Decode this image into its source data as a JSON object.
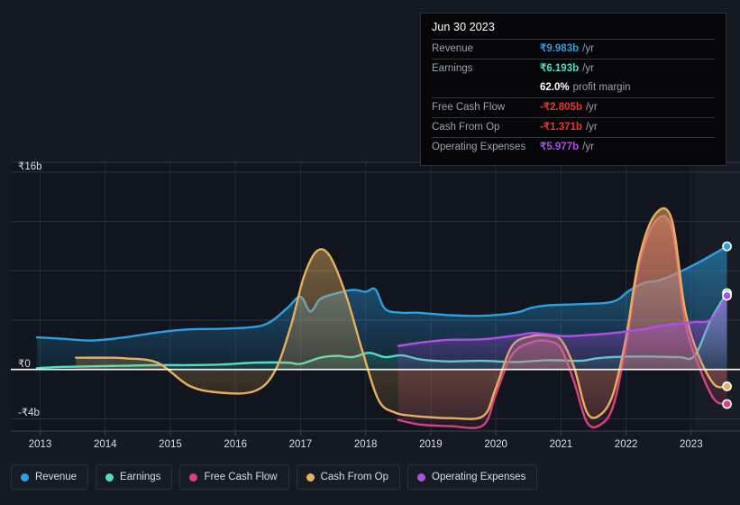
{
  "chart_data": {
    "type": "area",
    "title": "",
    "xlabel": "",
    "ylabel": "",
    "currency_symbol": "₹",
    "units": "b",
    "grid": true,
    "legend_position": "bottom",
    "xlim": [
      2012.55,
      2023.75
    ],
    "ylim": [
      -5.0,
      16.8
    ],
    "x_ticks": [
      "2013",
      "2014",
      "2015",
      "2016",
      "2017",
      "2018",
      "2019",
      "2020",
      "2021",
      "2022",
      "2023"
    ],
    "y_ticks": [
      "₹16b",
      "₹0",
      "-₹4b"
    ],
    "y_tick_values": [
      16,
      0,
      -4
    ],
    "highlight_band_start": 2023.05,
    "series": [
      {
        "name": "Revenue",
        "color": "#2e9fe0",
        "x": [
          2012.95,
          2013.3,
          2013.8,
          2014.3,
          2014.8,
          2015.3,
          2015.8,
          2016.3,
          2016.55,
          2016.8,
          2017.0,
          2017.15,
          2017.3,
          2017.5,
          2017.8,
          2018.0,
          2018.15,
          2018.3,
          2018.55,
          2018.8,
          2019.3,
          2019.8,
          2020.3,
          2020.55,
          2020.8,
          2021.3,
          2021.8,
          2022.05,
          2022.3,
          2022.55,
          2023.05,
          2023.55
        ],
        "values": [
          2.6,
          2.5,
          2.35,
          2.6,
          3.0,
          3.25,
          3.3,
          3.45,
          3.9,
          5.0,
          5.9,
          4.7,
          5.7,
          6.1,
          6.45,
          6.3,
          6.5,
          4.9,
          4.6,
          4.6,
          4.4,
          4.35,
          4.6,
          5.0,
          5.2,
          5.3,
          5.5,
          6.4,
          7.05,
          7.3,
          8.5,
          9.983
        ]
      },
      {
        "name": "Earnings",
        "color": "#4fe0c0",
        "x": [
          2012.95,
          2013.3,
          2013.8,
          2014.3,
          2014.8,
          2015.3,
          2015.8,
          2016.3,
          2016.8,
          2017.0,
          2017.3,
          2017.55,
          2017.8,
          2018.05,
          2018.3,
          2018.55,
          2018.8,
          2019.05,
          2019.3,
          2019.8,
          2020.3,
          2020.8,
          2021.3,
          2021.55,
          2021.8,
          2022.3,
          2022.8,
          2023.05,
          2023.3,
          2023.55
        ],
        "values": [
          0.1,
          0.2,
          0.25,
          0.3,
          0.35,
          0.35,
          0.4,
          0.55,
          0.55,
          0.45,
          0.95,
          1.1,
          1.0,
          1.35,
          1.0,
          1.15,
          0.85,
          0.7,
          0.65,
          0.7,
          0.6,
          0.75,
          0.7,
          0.9,
          1.0,
          1.05,
          1.0,
          1.1,
          4.0,
          6.193
        ]
      },
      {
        "name": "Free Cash Flow",
        "color": "#d6417f",
        "x": [
          2018.5,
          2018.8,
          2019.05,
          2019.3,
          2019.8,
          2020.0,
          2020.25,
          2020.55,
          2020.8,
          2021.0,
          2021.2,
          2021.4,
          2021.6,
          2021.8,
          2022.0,
          2022.2,
          2022.45,
          2022.7,
          2022.9,
          2023.1,
          2023.35,
          2023.55
        ],
        "values": [
          -4.1,
          -4.45,
          -4.55,
          -4.6,
          -4.55,
          -2.0,
          1.2,
          2.2,
          2.3,
          1.7,
          -1.0,
          -4.3,
          -4.5,
          -3.0,
          2.0,
          8.5,
          12.0,
          11.5,
          4.0,
          0.5,
          -2.4,
          -2.805
        ]
      },
      {
        "name": "Cash From Op",
        "color": "#e8b05c",
        "x": [
          2013.55,
          2014.0,
          2014.3,
          2014.8,
          2015.3,
          2015.8,
          2016.3,
          2016.6,
          2016.85,
          2017.05,
          2017.25,
          2017.45,
          2017.7,
          2017.95,
          2018.2,
          2018.45,
          2018.7,
          2019.05,
          2019.3,
          2019.8,
          2020.0,
          2020.25,
          2020.55,
          2020.8,
          2021.0,
          2021.2,
          2021.4,
          2021.6,
          2021.8,
          2022.0,
          2022.2,
          2022.45,
          2022.7,
          2022.9,
          2023.1,
          2023.35,
          2023.55
        ],
        "values": [
          0.95,
          0.95,
          0.9,
          0.55,
          -1.35,
          -1.9,
          -1.75,
          -0.2,
          3.5,
          7.5,
          9.6,
          9.2,
          6.0,
          1.5,
          -2.5,
          -3.5,
          -3.75,
          -3.9,
          -3.95,
          -3.8,
          -1.5,
          1.9,
          2.7,
          2.75,
          2.4,
          0.2,
          -3.5,
          -3.7,
          -2.0,
          2.6,
          9.0,
          12.6,
          12.2,
          5.0,
          1.3,
          -1.2,
          -1.371
        ]
      },
      {
        "name": "Operating Expenses",
        "color": "#b04fe8",
        "x": [
          2018.5,
          2018.8,
          2019.05,
          2019.3,
          2019.8,
          2020.3,
          2020.55,
          2020.8,
          2021.05,
          2021.3,
          2021.8,
          2022.3,
          2022.55,
          2022.8,
          2023.05,
          2023.3,
          2023.55
        ],
        "values": [
          1.9,
          2.15,
          2.3,
          2.4,
          2.45,
          2.75,
          2.95,
          2.85,
          2.7,
          2.75,
          2.95,
          3.3,
          3.55,
          3.7,
          3.85,
          4.05,
          5.977
        ]
      }
    ],
    "endpoints": [
      {
        "name": "Revenue",
        "x": 2023.55,
        "value": 9.983,
        "color": "#2e9fe0"
      },
      {
        "name": "Earnings",
        "x": 2023.55,
        "value": 6.193,
        "color": "#4fe0c0"
      },
      {
        "name": "Operating Expenses",
        "x": 2023.55,
        "value": 5.977,
        "color": "#b04fe8"
      },
      {
        "name": "Cash From Op",
        "x": 2023.55,
        "value": -1.371,
        "color": "#e8b05c"
      },
      {
        "name": "Free Cash Flow",
        "x": 2023.55,
        "value": -2.805,
        "color": "#d6417f"
      }
    ]
  },
  "tooltip": {
    "date": "Jun 30 2023",
    "rows": [
      {
        "label": "Revenue",
        "value": "₹9.983b",
        "unit": "/yr",
        "color": "#2e9fe0"
      },
      {
        "label": "Earnings",
        "value": "₹6.193b",
        "unit": "/yr",
        "color": "#4fe0c0"
      },
      {
        "label": "",
        "value": "62.0%",
        "unit": "profit margin",
        "color": "#ffffff"
      },
      {
        "label": "Free Cash Flow",
        "value": "-₹2.805b",
        "unit": "/yr",
        "color": "#e8372f"
      },
      {
        "label": "Cash From Op",
        "value": "-₹1.371b",
        "unit": "/yr",
        "color": "#e8372f"
      },
      {
        "label": "Operating Expenses",
        "value": "₹5.977b",
        "unit": "/yr",
        "color": "#b04fe8"
      }
    ]
  },
  "legend": {
    "items": [
      {
        "label": "Revenue",
        "color": "#2e9fe0"
      },
      {
        "label": "Earnings",
        "color": "#4fe0c0"
      },
      {
        "label": "Free Cash Flow",
        "color": "#d6417f"
      },
      {
        "label": "Cash From Op",
        "color": "#e8b05c"
      },
      {
        "label": "Operating Expenses",
        "color": "#b04fe8"
      }
    ]
  },
  "theme": {
    "background": "#141a24",
    "plot_background": "#10151e",
    "grid_color": "#2a3favoid",
    "zero_line_color": "#ffffff",
    "axis_text": "#d9dee6"
  }
}
